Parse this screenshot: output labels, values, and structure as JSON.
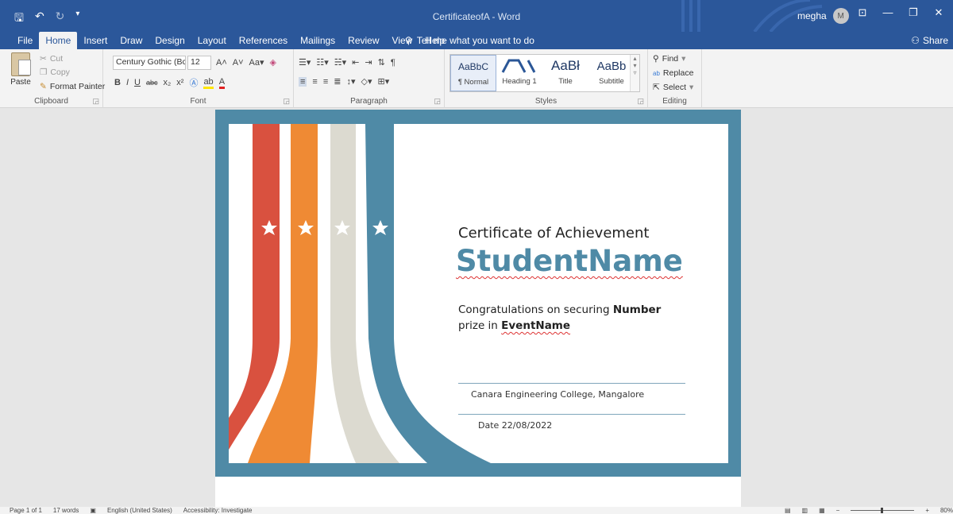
{
  "window": {
    "title": "CertificateofA  -  Word",
    "user_name": "megha",
    "user_initial": "M"
  },
  "menu": {
    "tabs": [
      "File",
      "Home",
      "Insert",
      "Draw",
      "Design",
      "Layout",
      "References",
      "Mailings",
      "Review",
      "View",
      "Help"
    ],
    "active_tab": "Home",
    "tell_me": "Tell me what you want to do",
    "share": "Share"
  },
  "ribbon": {
    "clipboard": {
      "label": "Clipboard",
      "paste": "Paste",
      "cut": "Cut",
      "copy": "Copy",
      "format_painter": "Format Painter"
    },
    "font": {
      "label": "Font",
      "family": "Century Gothic (Bc",
      "size": "12"
    },
    "paragraph": {
      "label": "Paragraph"
    },
    "styles": {
      "label": "Styles",
      "items": [
        {
          "preview": "AaBbC",
          "name": "¶ Normal"
        },
        {
          "preview": "Heading 1",
          "name": "Heading 1"
        },
        {
          "preview": "AaBł",
          "name": "Title"
        },
        {
          "preview": "AaBb",
          "name": "Subtitle"
        }
      ]
    },
    "editing": {
      "label": "Editing",
      "find": "Find",
      "replace": "Replace",
      "select": "Select"
    }
  },
  "certificate": {
    "title": "Certificate of Achievement",
    "student_name": "StudentName",
    "msg_prefix": "Congratulations on securing ",
    "msg_number": "Number",
    "msg_middle": "prize in ",
    "msg_event": "EventName",
    "college": "Canara Engineering College, Mangalore",
    "date": "Date 22/08/2022",
    "colors": {
      "teal": "#4f8aa6",
      "red": "#d9513f",
      "orange": "#ef8a34",
      "beige": "#dcdad0"
    }
  },
  "status": {
    "page": "Page 1 of 1",
    "words": "17 words",
    "language": "English (United States)",
    "accessibility": "Accessibility: Investigate",
    "zoom": "80%"
  }
}
